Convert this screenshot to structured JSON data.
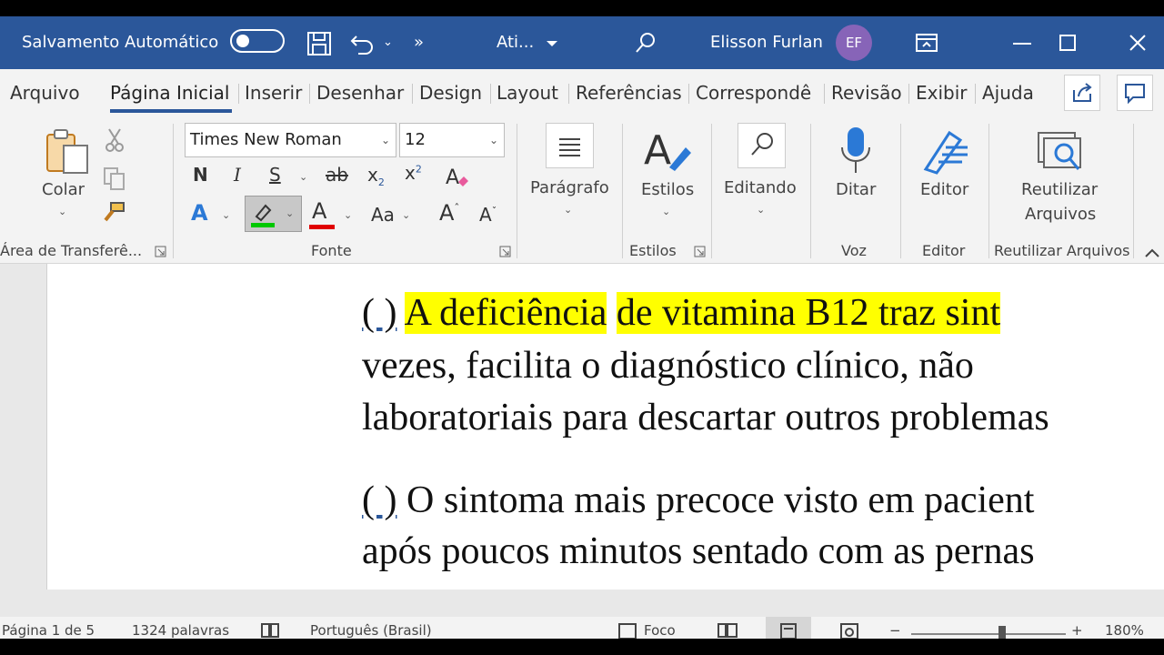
{
  "titlebar": {
    "autosave_label": "Salvamento Automático",
    "doc_title": "Ati...",
    "user_name": "Elisson Furlan",
    "user_initials": "EF"
  },
  "tabs": [
    "Arquivo",
    "Página Inicial",
    "Inserir",
    "Desenhar",
    "Design",
    "Layout",
    "Referências",
    "Correspondê",
    "Revisão",
    "Exibir",
    "Ajuda"
  ],
  "ribbon": {
    "paste_label": "Colar",
    "clipboard_group": "Área de Transferê...",
    "font_name": "Times New Roman",
    "font_size": "12",
    "font_group": "Fonte",
    "paragraph_label": "Parágrafo",
    "styles_label": "Estilos",
    "styles_group": "Estilos",
    "editing_label": "Editando",
    "dictate_label": "Ditar",
    "voice_group": "Voz",
    "editor_label": "Editor",
    "editor_group": "Editor",
    "reuse_label_1": "Reutilizar",
    "reuse_label_2": "Arquivos",
    "reuse_group": "Reutilizar Arquivos",
    "bold": "N",
    "italic": "I",
    "underline": "S",
    "strike": "ab",
    "subscript": "x",
    "superscript": "x",
    "change_case": "Aa",
    "grow_font": "A",
    "shrink_font": "A",
    "font_color": "A",
    "text_effects": "A"
  },
  "document": {
    "p1_blank": "(   )",
    "p1_hl1": "A deficiência",
    "p1_hl2": "de vitamina B12 traz sint",
    "p1_line2": "vezes,   facilita   o   diagnóstico   clínico,   não",
    "p1_line3": "laboratoriais para descartar outros problemas",
    "p2_blank": "(  )",
    "p2_line1": " O sintoma mais precoce visto em pacient",
    "p2_line2": "após  poucos  minutos  sentado  com  as  pernas"
  },
  "statusbar": {
    "page": "Página 1 de 5",
    "words": "1324 palavras",
    "language": "Português (Brasil)",
    "focus": "Foco",
    "zoom": "180%"
  },
  "colors": {
    "title_blue": "#2b579a",
    "highlight": "#ffff00",
    "highlight_bar": "#00c800",
    "font_color_bar": "#e00000"
  }
}
